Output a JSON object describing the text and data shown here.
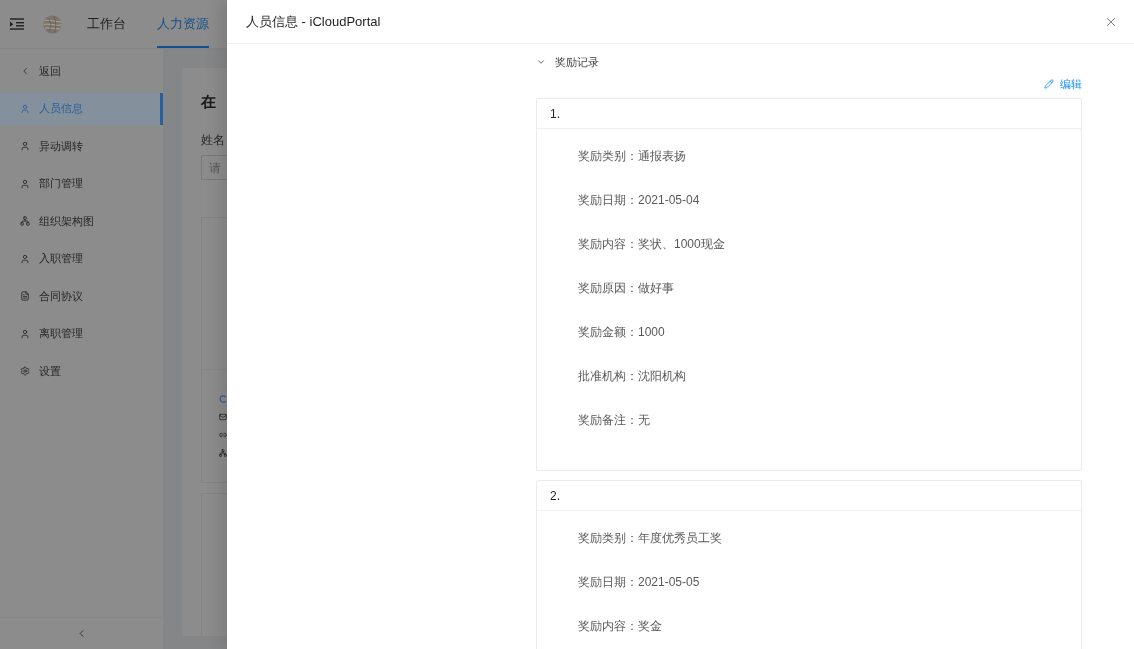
{
  "header": {
    "tabs": [
      {
        "label": "工作台",
        "selected": false
      },
      {
        "label": "人力资源",
        "selected": true
      }
    ]
  },
  "sidebar": {
    "back": {
      "label": "返回"
    },
    "items": [
      {
        "label": "人员信息",
        "selected": true
      },
      {
        "label": "异动调转",
        "selected": false
      },
      {
        "label": "部门管理",
        "selected": false
      },
      {
        "label": "组织架构图",
        "selected": false
      },
      {
        "label": "入职管理",
        "selected": false
      },
      {
        "label": "合同协议",
        "selected": false
      },
      {
        "label": "离职管理",
        "selected": false
      },
      {
        "label": "设置",
        "selected": false
      }
    ]
  },
  "background_page": {
    "title": "在",
    "field_label": "姓名",
    "placeholder": "请"
  },
  "drawer": {
    "title": "人员信息 - iCloudPortal",
    "section": {
      "title": "奖励记录",
      "expanded": true,
      "edit_label": "编辑",
      "records": [
        {
          "number": "1.",
          "fields": [
            {
              "label": "奖励类别：",
              "value": "通报表扬"
            },
            {
              "label": "奖励日期：",
              "value": "2021-05-04"
            },
            {
              "label": "奖励内容：",
              "value": "奖状、1000现金"
            },
            {
              "label": "奖励原因：",
              "value": "做好事"
            },
            {
              "label": "奖励金额：",
              "value": "1000"
            },
            {
              "label": "批准机构：",
              "value": "沈阳机构"
            },
            {
              "label": "奖励备注：",
              "value": "无"
            }
          ]
        },
        {
          "number": "2.",
          "fields": [
            {
              "label": "奖励类别：",
              "value": "年度优秀员工奖"
            },
            {
              "label": "奖励日期：",
              "value": "2021-05-05"
            },
            {
              "label": "奖励内容：",
              "value": "奖金"
            }
          ]
        }
      ]
    }
  }
}
